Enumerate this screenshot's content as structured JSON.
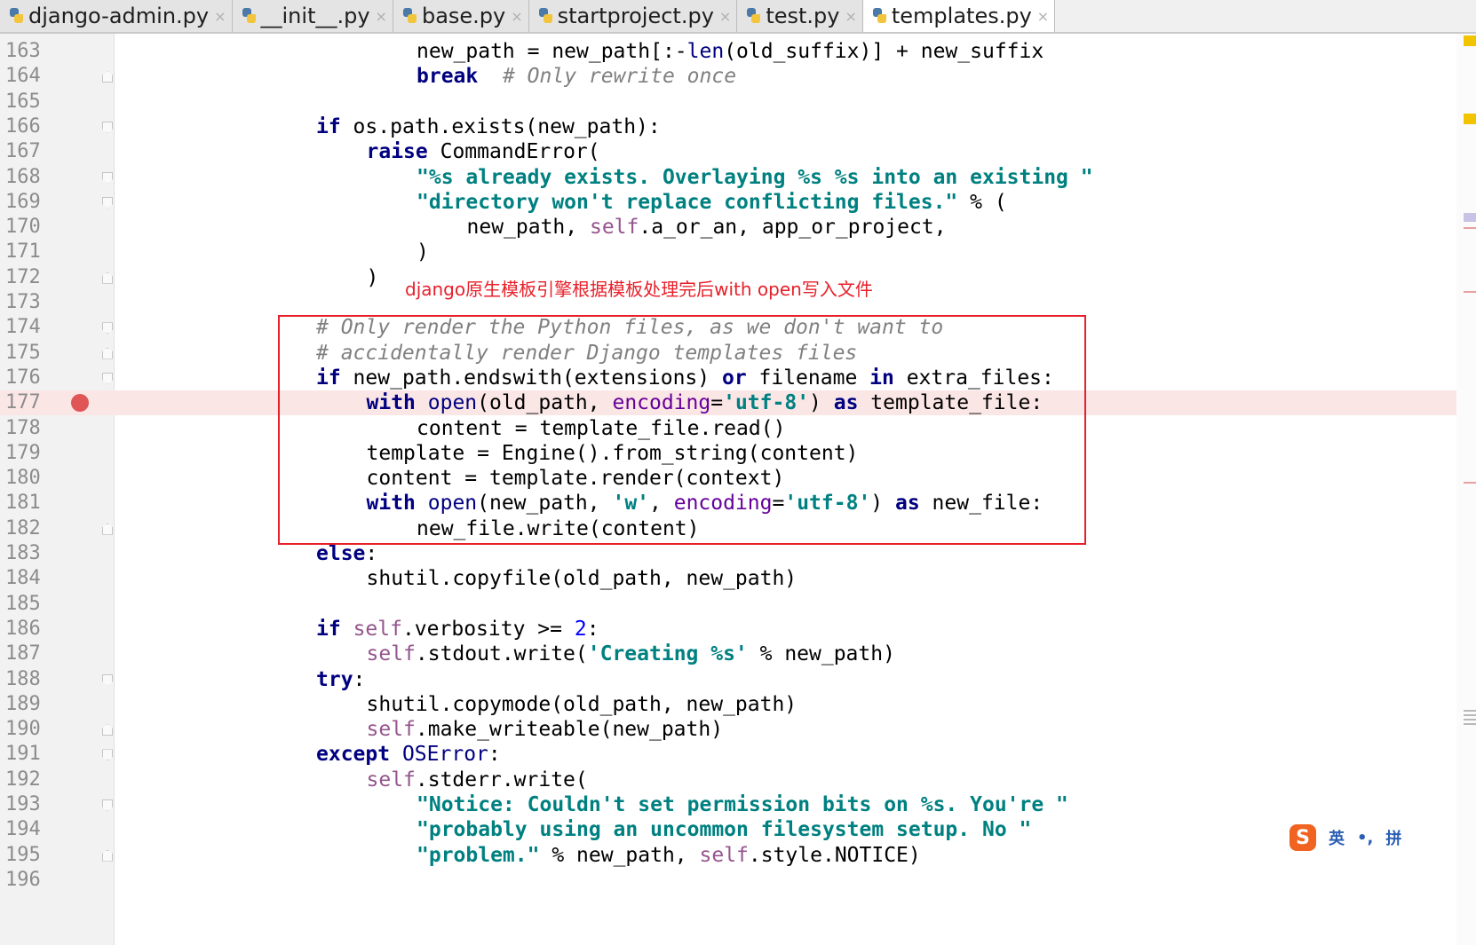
{
  "tabs": [
    {
      "label": "django-admin.py",
      "active": false
    },
    {
      "label": "__init__.py",
      "active": false
    },
    {
      "label": "base.py",
      "active": false
    },
    {
      "label": "startproject.py",
      "active": false
    },
    {
      "label": "test.py",
      "active": false
    },
    {
      "label": "templates.py",
      "active": true
    }
  ],
  "tab_close_glyph": "×",
  "annotation": "django原生模板引擎根据模板处理完后with open写入文件",
  "breakpoint_line": 177,
  "lines": [
    {
      "n": "163",
      "indent": 4,
      "fold": "",
      "tokens": [
        [
          "",
          "new_path = new_path[:-"
        ],
        [
          "bi",
          "len"
        ],
        [
          "",
          "(old_suffix)] + new_suffix"
        ]
      ]
    },
    {
      "n": "164",
      "indent": 4,
      "fold": "up",
      "tokens": [
        [
          "kw",
          "break"
        ],
        [
          "",
          "  "
        ],
        [
          "cmt",
          "# Only rewrite once"
        ]
      ]
    },
    {
      "n": "165",
      "indent": 0,
      "fold": "",
      "tokens": []
    },
    {
      "n": "166",
      "indent": 2,
      "fold": "down",
      "tokens": [
        [
          "kw",
          "if"
        ],
        [
          "",
          " os.path.exists(new_path):"
        ]
      ]
    },
    {
      "n": "167",
      "indent": 3,
      "fold": "",
      "tokens": [
        [
          "kw",
          "raise"
        ],
        [
          "",
          " CommandError("
        ]
      ]
    },
    {
      "n": "168",
      "indent": 4,
      "fold": "down",
      "tokens": [
        [
          "str",
          "\"%s already exists. Overlaying %s %s into an existing \""
        ]
      ]
    },
    {
      "n": "169",
      "indent": 4,
      "fold": "down",
      "tokens": [
        [
          "str",
          "\"directory won't replace conflicting files.\""
        ],
        [
          "",
          " % ("
        ]
      ]
    },
    {
      "n": "170",
      "indent": 5,
      "fold": "",
      "tokens": [
        [
          "",
          "new_path, "
        ],
        [
          "selfc",
          "self"
        ],
        [
          "",
          ".a_or_an, app_or_project,"
        ]
      ]
    },
    {
      "n": "171",
      "indent": 4,
      "fold": "",
      "tokens": [
        [
          "",
          ")"
        ]
      ]
    },
    {
      "n": "172",
      "indent": 3,
      "fold": "up",
      "tokens": [
        [
          "",
          ")"
        ]
      ]
    },
    {
      "n": "173",
      "indent": 0,
      "fold": "",
      "tokens": []
    },
    {
      "n": "174",
      "indent": 2,
      "fold": "down",
      "tokens": [
        [
          "cmt",
          "# Only render the Python files, as we don't want to"
        ]
      ]
    },
    {
      "n": "175",
      "indent": 2,
      "fold": "up",
      "tokens": [
        [
          "cmt",
          "# accidentally render Django templates files"
        ]
      ]
    },
    {
      "n": "176",
      "indent": 2,
      "fold": "down",
      "tokens": [
        [
          "kw",
          "if"
        ],
        [
          "",
          " new_path.endswith(extensions) "
        ],
        [
          "kw",
          "or"
        ],
        [
          "",
          " filename "
        ],
        [
          "kw",
          "in"
        ],
        [
          "",
          " extra_files:"
        ]
      ]
    },
    {
      "n": "177",
      "indent": 3,
      "fold": "",
      "tokens": [
        [
          "kw",
          "with"
        ],
        [
          "",
          " "
        ],
        [
          "bi",
          "open"
        ],
        [
          "",
          "(old_path, "
        ],
        [
          "kwarg",
          "encoding"
        ],
        [
          "",
          "="
        ],
        [
          "str",
          "'utf-8'"
        ],
        [
          "",
          ") "
        ],
        [
          "kw",
          "as"
        ],
        [
          "",
          " template_file:"
        ]
      ]
    },
    {
      "n": "178",
      "indent": 4,
      "fold": "",
      "tokens": [
        [
          "",
          "content = template_file.read()"
        ]
      ]
    },
    {
      "n": "179",
      "indent": 3,
      "fold": "",
      "tokens": [
        [
          "",
          "template = Engine().from_string(content)"
        ]
      ]
    },
    {
      "n": "180",
      "indent": 3,
      "fold": "",
      "tokens": [
        [
          "",
          "content = template.render(context)"
        ]
      ]
    },
    {
      "n": "181",
      "indent": 3,
      "fold": "",
      "tokens": [
        [
          "kw",
          "with"
        ],
        [
          "",
          " "
        ],
        [
          "bi",
          "open"
        ],
        [
          "",
          "(new_path, "
        ],
        [
          "str",
          "'w'"
        ],
        [
          "",
          ", "
        ],
        [
          "kwarg",
          "encoding"
        ],
        [
          "",
          "="
        ],
        [
          "str",
          "'utf-8'"
        ],
        [
          "",
          ") "
        ],
        [
          "kw",
          "as"
        ],
        [
          "",
          " new_file:"
        ]
      ]
    },
    {
      "n": "182",
      "indent": 4,
      "fold": "up",
      "tokens": [
        [
          "",
          "new_file.write(content)"
        ]
      ]
    },
    {
      "n": "183",
      "indent": 2,
      "fold": "",
      "tokens": [
        [
          "kw",
          "else"
        ],
        [
          "",
          ":"
        ]
      ]
    },
    {
      "n": "184",
      "indent": 3,
      "fold": "",
      "tokens": [
        [
          "",
          "shutil.copyfile(old_path, new_path)"
        ]
      ]
    },
    {
      "n": "185",
      "indent": 0,
      "fold": "",
      "tokens": []
    },
    {
      "n": "186",
      "indent": 2,
      "fold": "",
      "tokens": [
        [
          "kw",
          "if"
        ],
        [
          "",
          " "
        ],
        [
          "selfc",
          "self"
        ],
        [
          "",
          ".verbosity >= "
        ],
        [
          "num",
          "2"
        ],
        [
          "",
          ":"
        ]
      ]
    },
    {
      "n": "187",
      "indent": 3,
      "fold": "",
      "tokens": [
        [
          "selfc",
          "self"
        ],
        [
          "",
          ".stdout.write("
        ],
        [
          "str",
          "'Creating %s'"
        ],
        [
          "",
          " % new_path)"
        ]
      ]
    },
    {
      "n": "188",
      "indent": 2,
      "fold": "down",
      "tokens": [
        [
          "kw",
          "try"
        ],
        [
          "",
          ":"
        ]
      ]
    },
    {
      "n": "189",
      "indent": 3,
      "fold": "",
      "tokens": [
        [
          "",
          "shutil.copymode(old_path, new_path)"
        ]
      ]
    },
    {
      "n": "190",
      "indent": 3,
      "fold": "up",
      "tokens": [
        [
          "selfc",
          "self"
        ],
        [
          "",
          ".make_writeable(new_path)"
        ]
      ]
    },
    {
      "n": "191",
      "indent": 2,
      "fold": "down",
      "tokens": [
        [
          "kw",
          "except"
        ],
        [
          "",
          " "
        ],
        [
          "bi",
          "OSError"
        ],
        [
          "",
          ":"
        ]
      ]
    },
    {
      "n": "192",
      "indent": 3,
      "fold": "",
      "tokens": [
        [
          "selfc",
          "self"
        ],
        [
          "",
          ".stderr.write("
        ]
      ]
    },
    {
      "n": "193",
      "indent": 4,
      "fold": "down",
      "tokens": [
        [
          "str",
          "\"Notice: Couldn't set permission bits on %s. You're \""
        ]
      ]
    },
    {
      "n": "194",
      "indent": 4,
      "fold": "",
      "tokens": [
        [
          "str",
          "\"probably using an uncommon filesystem setup. No \""
        ]
      ]
    },
    {
      "n": "195",
      "indent": 4,
      "fold": "up",
      "tokens": [
        [
          "str",
          "\"problem.\""
        ],
        [
          "",
          " % new_path, "
        ],
        [
          "selfc",
          "self"
        ],
        [
          "",
          ".style.NOTICE)"
        ]
      ]
    },
    {
      "n": "196",
      "indent": 0,
      "fold": "",
      "tokens": []
    }
  ],
  "ime": {
    "logo": "S",
    "mode": "英",
    "punct": "•,",
    "input": "拼"
  },
  "colors": {
    "annotation": "#e8202a",
    "breakpoint": "#e05555",
    "breakpoint_line_bg": "#fbe6e6"
  }
}
